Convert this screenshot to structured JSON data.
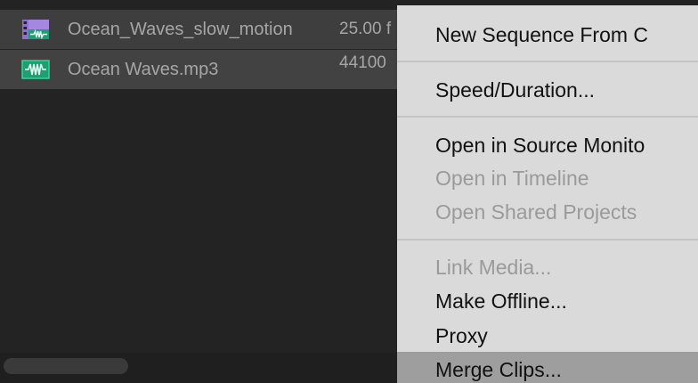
{
  "project_panel": {
    "items": [
      {
        "name": "Ocean_Waves_slow_motion",
        "rate": "25.00 f",
        "icon": "video-clip-icon",
        "icon_color": "#9a7ad8"
      },
      {
        "name": "Ocean Waves.mp3",
        "rate": "44100",
        "icon": "audio-clip-icon",
        "icon_color": "#2fbf8a"
      }
    ]
  },
  "context_menu": {
    "items": [
      {
        "label": "New Sequence From C",
        "enabled": true
      },
      {
        "label": "Speed/Duration...",
        "enabled": true
      },
      {
        "label": "Open in Source Monito",
        "enabled": true
      },
      {
        "label": "Open in Timeline",
        "enabled": false
      },
      {
        "label": "Open Shared Projects",
        "enabled": false
      },
      {
        "label": "Link Media...",
        "enabled": false
      },
      {
        "label": "Make Offline...",
        "enabled": true
      },
      {
        "label": "Proxy",
        "enabled": true
      },
      {
        "label": "Merge Clips...",
        "enabled": true,
        "highlighted": true
      }
    ]
  },
  "colors": {
    "panel_bg": "#232323",
    "menu_bg": "#dadada",
    "menu_highlight": "#9e9e9e",
    "disabled_text": "#9a9a9a"
  }
}
